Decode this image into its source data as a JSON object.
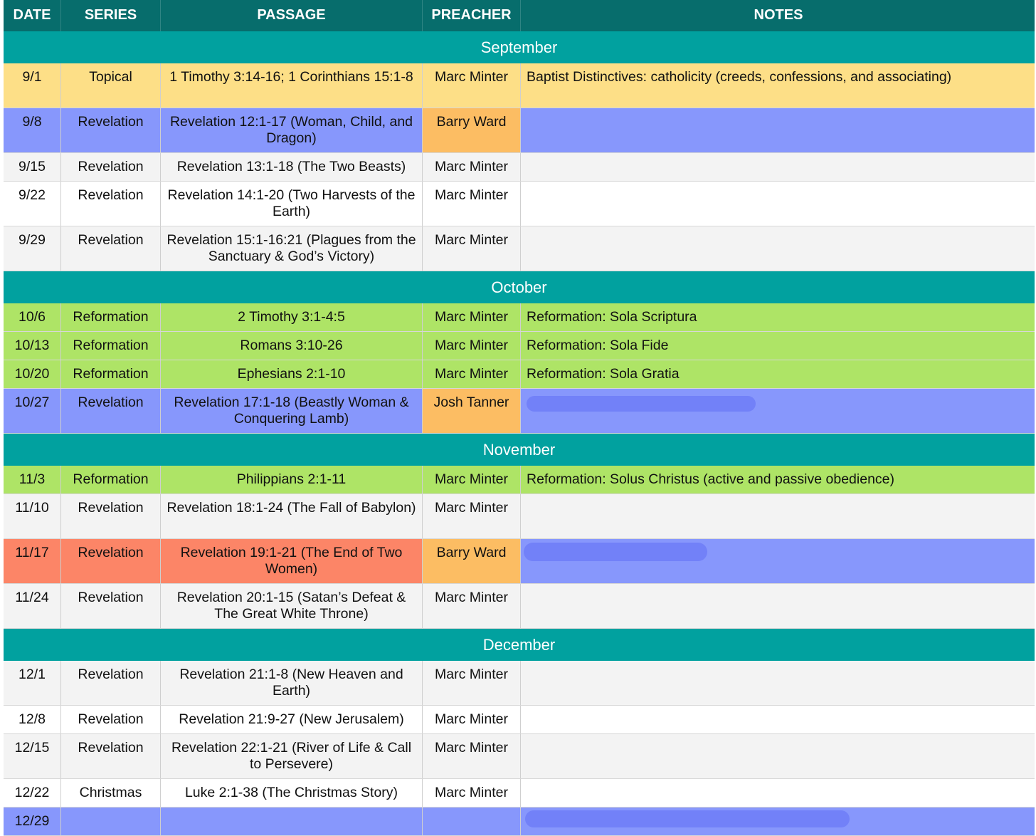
{
  "headers": [
    "DATE",
    "SERIES",
    "PASSAGE",
    "PREACHER",
    "NOTES"
  ],
  "colors": {
    "header_bg": "#076d6c",
    "month_bg": "#01a19f",
    "white": "#ffffff",
    "gray": "#f3f3f3",
    "yellow": "#fddf87",
    "blue": "#8797fc",
    "green": "#aee466",
    "orange": "#fcbd63",
    "red": "#fc8567"
  },
  "rows": [
    {
      "type": "month",
      "label": "September"
    },
    {
      "type": "entry",
      "h": 2,
      "date": "9/1",
      "series": "Topical",
      "passage": "1 Timothy 3:14-16; 1 Corinthians 15:1-8",
      "preacher": "Marc Minter",
      "notes": "Baptist Distinctives: catholicity (creeds, confessions, and associating)",
      "bg": "yellow",
      "bgs": {}
    },
    {
      "type": "entry",
      "h": 2,
      "date": "9/8",
      "series": "Revelation",
      "passage": "Revelation 12:1-17 (Woman, Child, and Dragon)",
      "preacher": "Barry Ward",
      "notes": "",
      "bg": "blue",
      "bgs": {
        "preacher": "orange"
      }
    },
    {
      "type": "entry",
      "h": 1,
      "date": "9/15",
      "series": "Revelation",
      "passage": "Revelation 13:1-18 (The Two Beasts)",
      "preacher": "Marc Minter",
      "notes": "",
      "bg": "gray",
      "bgs": {}
    },
    {
      "type": "entry",
      "h": 2,
      "date": "9/22",
      "series": "Revelation",
      "passage": "Revelation 14:1-20 (Two Harvests of the Earth)",
      "preacher": "Marc Minter",
      "notes": "",
      "bg": "white",
      "bgs": {}
    },
    {
      "type": "entry",
      "h": 2,
      "date": "9/29",
      "series": "Revelation",
      "passage": "Revelation 15:1-16:21 (Plagues from the Sanctuary & God’s Victory)",
      "preacher": "Marc Minter",
      "notes": "",
      "bg": "gray",
      "bgs": {}
    },
    {
      "type": "month",
      "label": "October"
    },
    {
      "type": "entry",
      "h": 1,
      "date": "10/6",
      "series": "Reformation",
      "passage": "2 Timothy 3:1-4:5",
      "preacher": "Marc Minter",
      "notes": "Reformation: Sola Scriptura",
      "bg": "green",
      "bgs": {}
    },
    {
      "type": "entry",
      "h": 1,
      "date": "10/13",
      "series": "Reformation",
      "passage": "Romans 3:10-26",
      "preacher": "Marc Minter",
      "notes": "Reformation: Sola Fide",
      "bg": "green",
      "bgs": {}
    },
    {
      "type": "entry",
      "h": 1,
      "date": "10/20",
      "series": "Reformation",
      "passage": "Ephesians 2:1-10",
      "preacher": "Marc Minter",
      "notes": "Reformation: Sola Gratia",
      "bg": "green",
      "bgs": {}
    },
    {
      "type": "entry",
      "h": 2,
      "date": "10/27",
      "series": "Revelation",
      "passage": "Revelation 17:1-18 (Beastly Woman & Conquering Lamb)",
      "preacher": "Josh Tanner",
      "notes": "",
      "bg": "blue",
      "bgs": {
        "preacher": "orange"
      }
    },
    {
      "type": "month",
      "label": "November"
    },
    {
      "type": "entry",
      "h": 1,
      "date": "11/3",
      "series": "Reformation",
      "passage": "Philippians 2:1-11",
      "preacher": "Marc Minter",
      "notes": "Reformation: Solus Christus (active and passive obedience)",
      "bg": "green",
      "bgs": {}
    },
    {
      "type": "entry",
      "h": 2,
      "date": "11/10",
      "series": "Revelation",
      "passage": "Revelation 18:1-24 (The Fall of Babylon)",
      "preacher": "Marc Minter",
      "notes": "",
      "bg": "gray",
      "bgs": {}
    },
    {
      "type": "entry",
      "h": 2,
      "date": "11/17",
      "series": "Revelation",
      "passage": "Revelation 19:1-21 (The End of Two Women)",
      "preacher": "Barry Ward",
      "notes": "",
      "bg": "red",
      "bgs": {
        "preacher": "orange",
        "notes": "blue"
      }
    },
    {
      "type": "entry",
      "h": 2,
      "date": "11/24",
      "series": "Revelation",
      "passage": "Revelation 20:1-15 (Satan’s Defeat & The Great White Throne)",
      "preacher": "Marc Minter",
      "notes": "",
      "bg": "gray",
      "bgs": {}
    },
    {
      "type": "month",
      "label": "December"
    },
    {
      "type": "entry",
      "h": 2,
      "date": "12/1",
      "series": "Revelation",
      "passage": "Revelation 21:1-8 (New Heaven and Earth)",
      "preacher": "Marc Minter",
      "notes": "",
      "bg": "gray",
      "bgs": {}
    },
    {
      "type": "entry",
      "h": 1,
      "date": "12/8",
      "series": "Revelation",
      "passage": "Revelation 21:9-27 (New Jerusalem)",
      "preacher": "Marc Minter",
      "notes": "",
      "bg": "white",
      "bgs": {}
    },
    {
      "type": "entry",
      "h": 2,
      "date": "12/15",
      "series": "Revelation",
      "passage": "Revelation 22:1-21 (River of Life & Call to Persevere)",
      "preacher": "Marc Minter",
      "notes": "",
      "bg": "gray",
      "bgs": {}
    },
    {
      "type": "entry",
      "h": 1,
      "date": "12/22",
      "series": "Christmas",
      "passage": "Luke 2:1-38 (The Christmas Story)",
      "preacher": "Marc Minter",
      "notes": "",
      "bg": "white",
      "bgs": {}
    },
    {
      "type": "entry",
      "h": 1,
      "date": "12/29",
      "series": "",
      "passage": "",
      "preacher": "",
      "notes": "",
      "bg": "blue",
      "bgs": {}
    }
  ]
}
